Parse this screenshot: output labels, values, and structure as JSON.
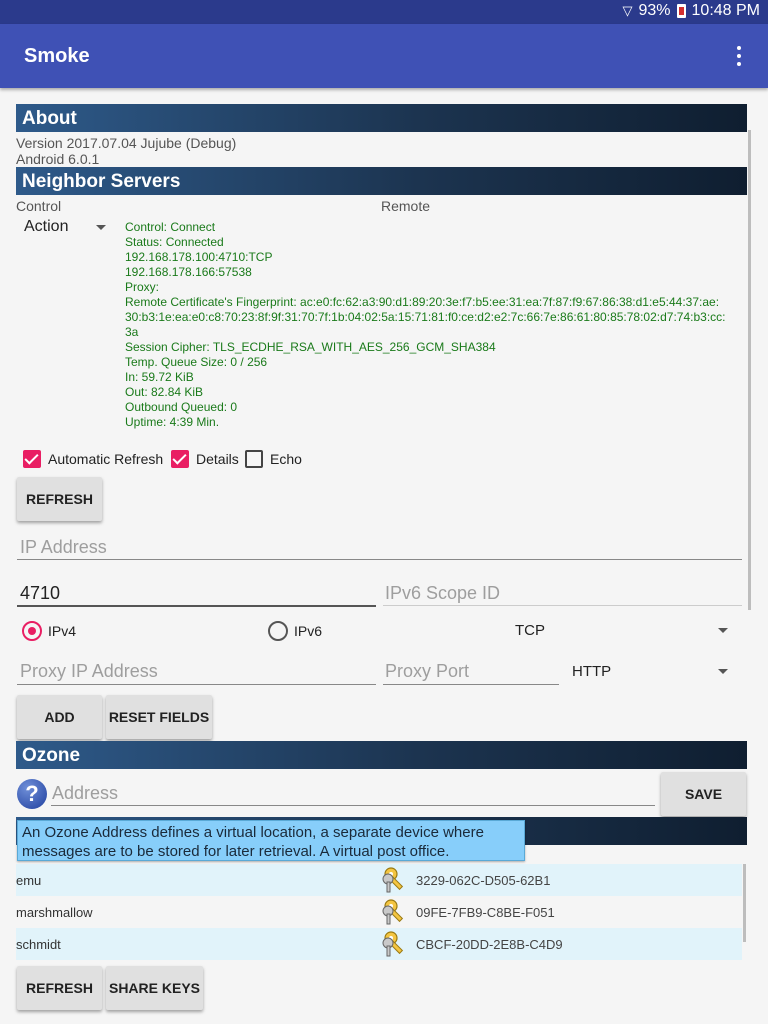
{
  "status_bar": {
    "battery": "93%",
    "time": "10:48 PM"
  },
  "app_bar": {
    "title": "Smoke",
    "menu_icon": "overflow-menu-icon"
  },
  "about": {
    "header": "About",
    "version": "Version 2017.07.04 Jujube (Debug)",
    "android": "Android 6.0.1"
  },
  "neighbors": {
    "header": "Neighbor Servers",
    "col_control": "Control",
    "col_remote": "Remote",
    "action": "Action",
    "details": [
      "Control: Connect",
      "Status: Connected",
      "192.168.178.100:4710:TCP",
      "192.168.178.166:57538",
      "Proxy:",
      "Remote Certificate's Fingerprint: ac:e0:fc:62:a3:90:d1:89:20:3e:f7:b5:ee:31:ea:7f:87:f9:67:86:38:d1:e5:44:37:ae:",
      "30:b3:1e:ea:e0:c8:70:23:8f:9f:31:70:7f:1b:04:02:5a:15:71:81:f0:ce:d2:e2:7c:66:7e:86:61:80:85:78:02:d7:74:b3:cc:",
      "3a",
      "Session Cipher: TLS_ECDHE_RSA_WITH_AES_256_GCM_SHA384",
      "Temp. Queue Size: 0 / 256",
      "In: 59.72 KiB",
      "Out: 82.84 KiB",
      "Outbound Queued: 0",
      "Uptime: 4:39 Min."
    ],
    "auto_refresh_label": "Automatic Refresh",
    "details_label": "Details",
    "echo_label": "Echo",
    "refresh_button": "REFRESH",
    "ip_placeholder": "IP Address",
    "port_value": "4710",
    "scope_placeholder": "IPv6 Scope ID",
    "ipv4_label": "IPv4",
    "ipv6_label": "IPv6",
    "transport": "TCP",
    "proxy_ip_placeholder": "Proxy IP Address",
    "proxy_port_placeholder": "Proxy Port",
    "proxy_type": "HTTP",
    "add_button": "ADD",
    "reset_button": "RESET FIELDS"
  },
  "ozone": {
    "header": "Ozone",
    "address_placeholder": "Address",
    "save_button": "SAVE",
    "tooltip": "An Ozone Address defines a virtual location, a separate device where messages are to be stored for later retrieval. A virtual post office.",
    "entries": [
      {
        "name": "emu",
        "key": "3229-062C-D505-62B1"
      },
      {
        "name": "marshmallow",
        "key": "09FE-7FB9-C8BE-F051"
      },
      {
        "name": "schmidt",
        "key": "CBCF-20DD-2E8B-C4D9"
      }
    ],
    "refresh_button": "REFRESH",
    "share_button": "SHARE KEYS"
  }
}
